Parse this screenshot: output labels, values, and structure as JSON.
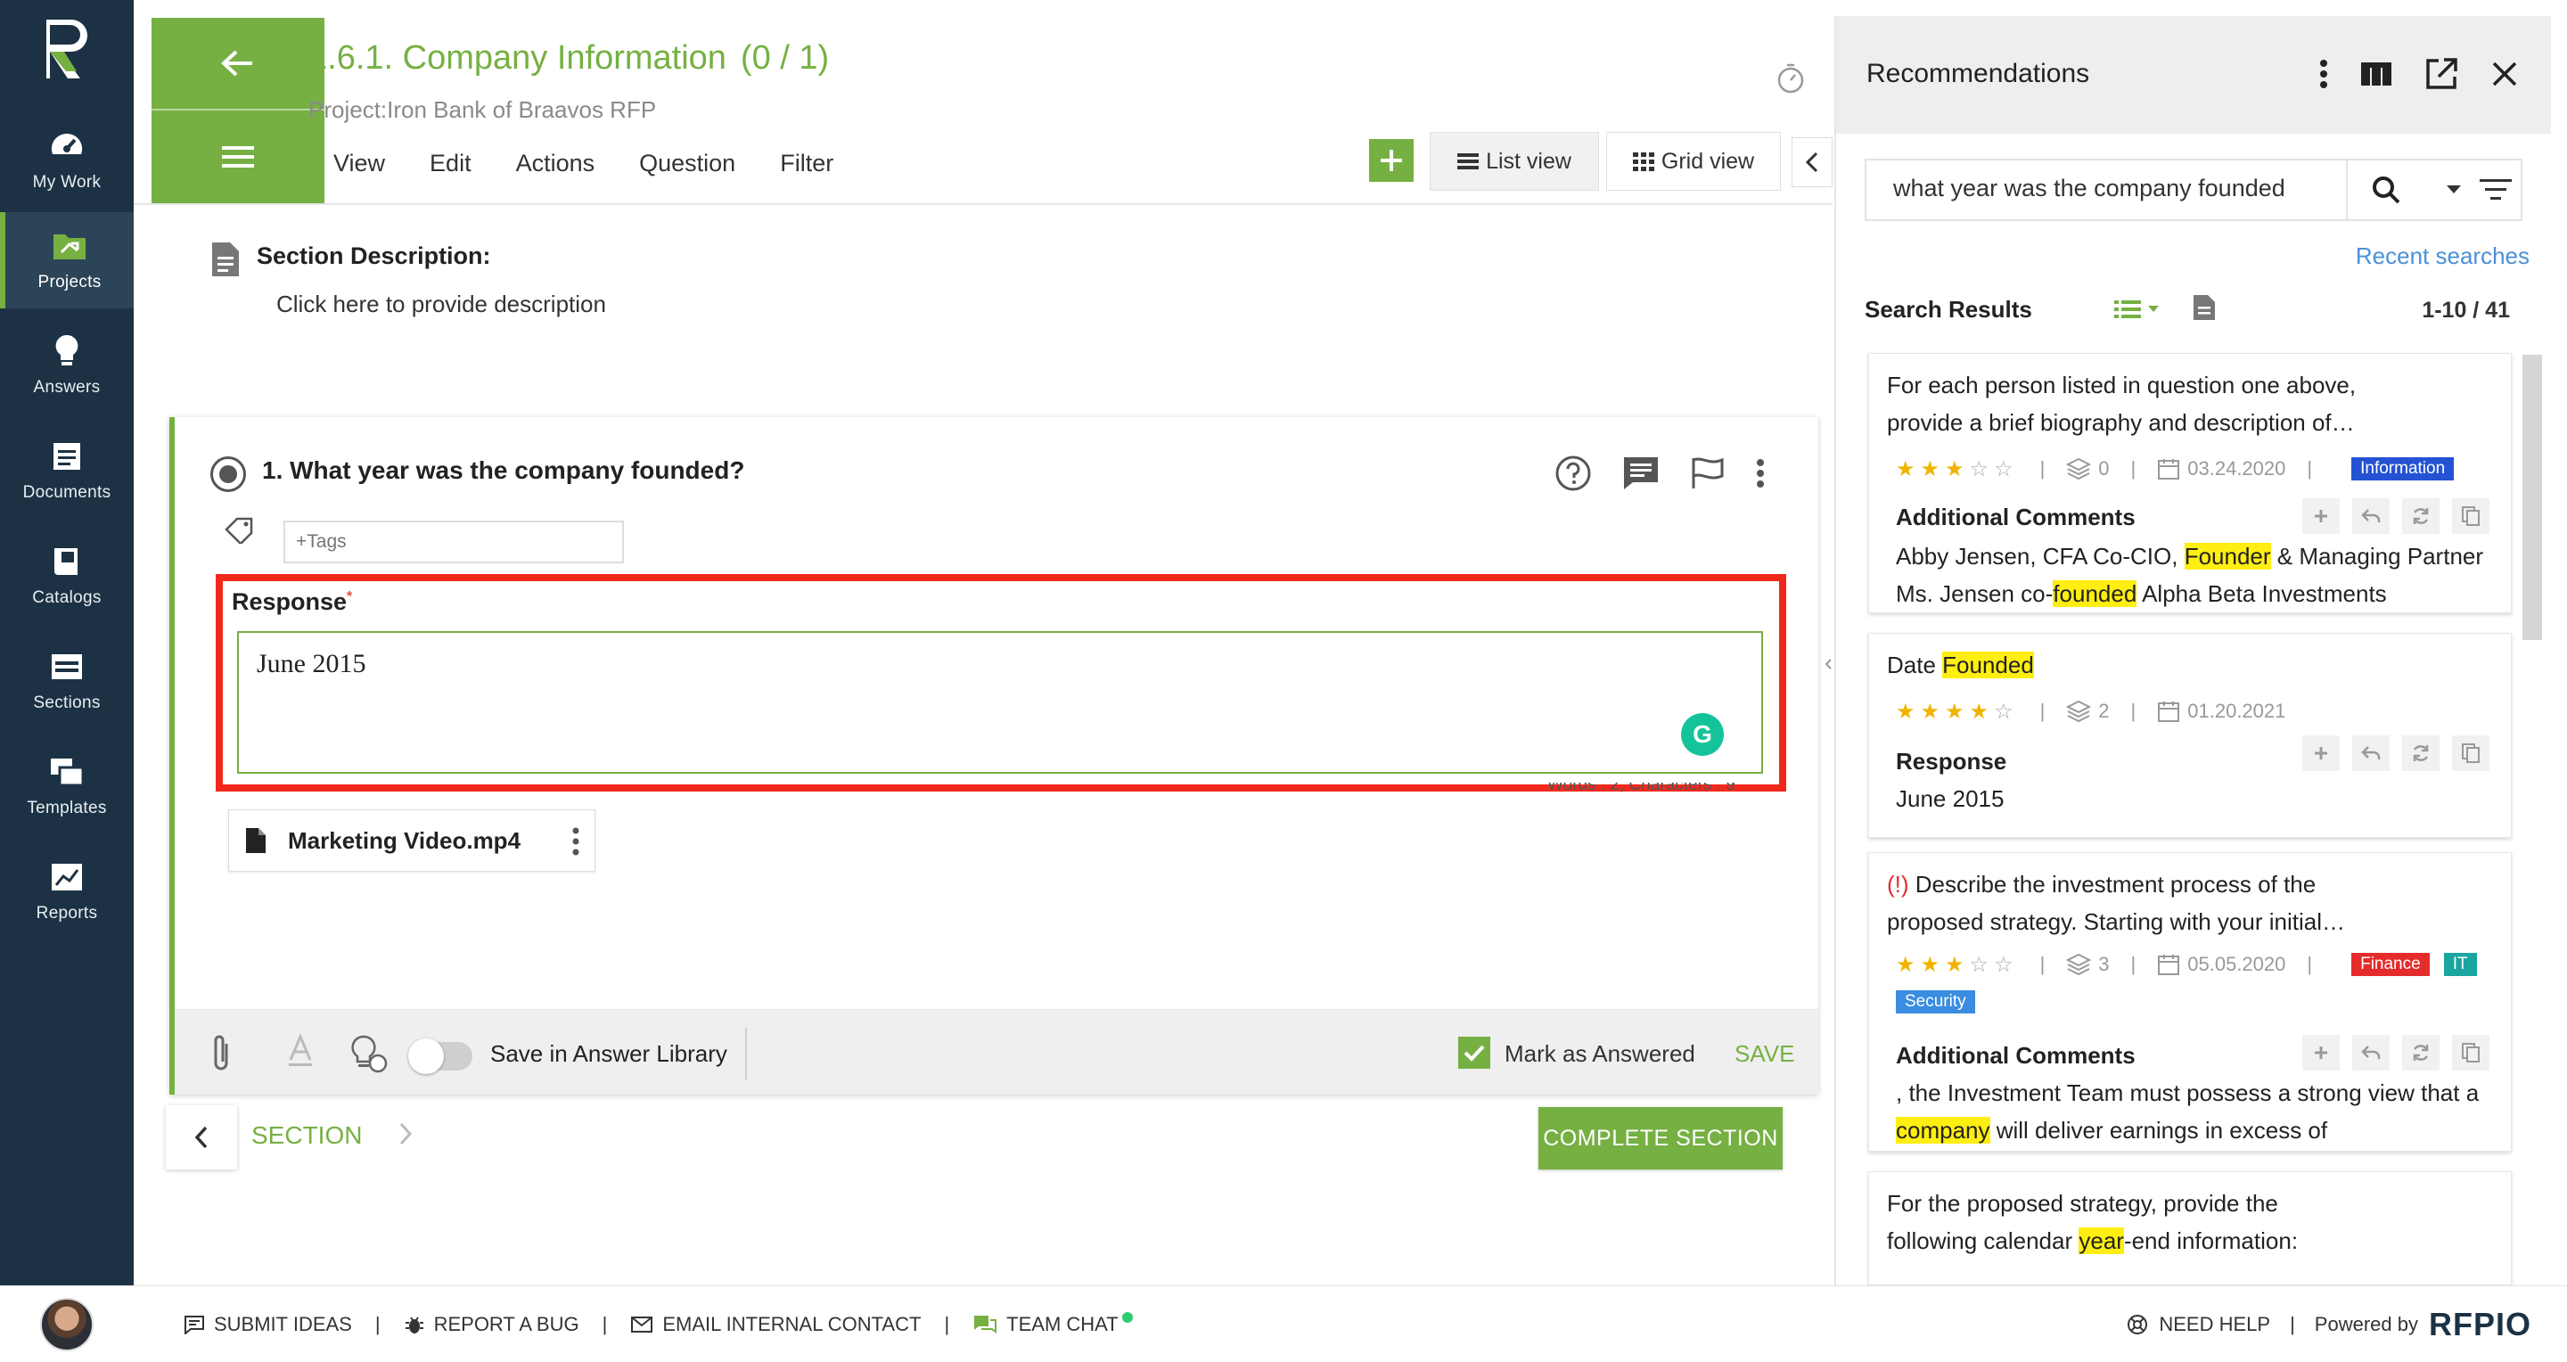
{
  "sidebar": {
    "items": [
      {
        "label": "My Work",
        "icon": "gauge-icon"
      },
      {
        "label": "Projects",
        "icon": "projects-folder-icon",
        "active": true
      },
      {
        "label": "Answers",
        "icon": "lightbulb-icon"
      },
      {
        "label": "Documents",
        "icon": "documents-icon"
      },
      {
        "label": "Catalogs",
        "icon": "catalog-book-icon"
      },
      {
        "label": "Sections",
        "icon": "sections-icon"
      },
      {
        "label": "Templates",
        "icon": "templates-icon"
      },
      {
        "label": "Reports",
        "icon": "reports-chart-icon"
      }
    ]
  },
  "header": {
    "title": "1.6.1. Company Information",
    "count": "(0 / 1)",
    "project": "Project:Iron Bank of Braavos RFP",
    "menu": [
      "View",
      "Edit",
      "Actions",
      "Question",
      "Filter"
    ],
    "list_view": "List view",
    "grid_view": "Grid view"
  },
  "section": {
    "desc_title": "Section Description:",
    "desc_placeholder": "Click here to provide description"
  },
  "question": {
    "title": "1. What year was the company founded?",
    "tags_placeholder": "+Tags",
    "response_label": "Response",
    "required_mark": "*",
    "response_value": "June 2015",
    "word_count": "Words : 2, Characters : 9",
    "attachment": "Marketing Video.mp4",
    "save_library": "Save in Answer Library",
    "mark_answered": "Mark as Answered",
    "save": "SAVE"
  },
  "section_nav": {
    "label": "SECTION",
    "complete": "COMPLETE SECTION"
  },
  "recommendations": {
    "title": "Recommendations",
    "search_query": "what year was the company founded",
    "recent": "Recent searches",
    "results_title": "Search Results",
    "results_count": "1-10 / 41",
    "cards": [
      {
        "title_line1": "For each person listed in question one above,",
        "title_line2": "provide a brief biography and description of…",
        "rating": 3,
        "versions": "0",
        "date": "03.24.2020",
        "tags": [
          "Information"
        ],
        "sub_head": "Additional Comments",
        "body_line1_a": "Abby Jensen, CFA Co-CIO, ",
        "body_line1_hl": "Founder",
        "body_line1_b": " & Managing Partner",
        "body_line2_a": "Ms. Jensen co-",
        "body_line2_hl": "founded",
        "body_line2_b": " Alpha Beta Investments"
      },
      {
        "title_a": "Date ",
        "title_hl": "Founded",
        "rating": 4,
        "versions": "2",
        "date": "01.20.2021",
        "sub_head": "Response",
        "body": "June 2015"
      },
      {
        "warn": "(!)",
        "title_line1": " Describe the investment process of the",
        "title_line2": "proposed strategy. Starting with your initial…",
        "rating": 3,
        "versions": "3",
        "date": "05.05.2020",
        "tags": [
          "Finance",
          "IT",
          "Security"
        ],
        "sub_head": "Additional Comments",
        "body_line1": ", the Investment Team must possess a strong view that a",
        "body_line2_hl": "company",
        "body_line2_b": " will deliver earnings in excess of"
      },
      {
        "title_line1": "For the proposed strategy, provide the",
        "title_line2_a": "following calendar ",
        "title_line2_hl": "year",
        "title_line2_b": "-end information:"
      }
    ]
  },
  "footer": {
    "links": [
      "SUBMIT IDEAS",
      "REPORT A BUG",
      "EMAIL INTERNAL CONTACT",
      "TEAM CHAT"
    ],
    "need_help": "NEED HELP",
    "powered_by": "Powered by",
    "brand": "RFPIO"
  },
  "colors": {
    "brand_green": "#76b043",
    "sidebar": "#1c3244",
    "highlight": "#ffee11",
    "response_outline": "#f2281d"
  }
}
